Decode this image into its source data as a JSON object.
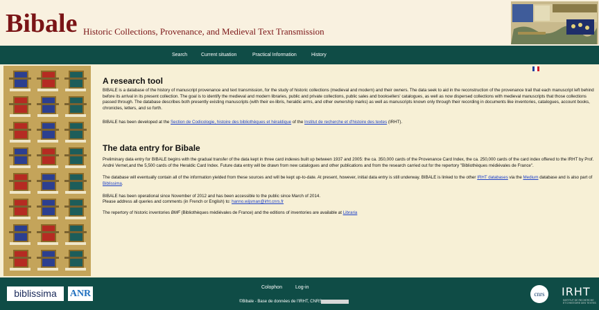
{
  "header": {
    "logo": "Bibale",
    "subtitle": "Historic Collections, Provenance, and Medieval Text Transmission"
  },
  "nav": {
    "items": [
      {
        "label": "Search"
      },
      {
        "label": "Current situation"
      },
      {
        "label": "Practical Information"
      },
      {
        "label": "History"
      }
    ]
  },
  "flag": {
    "colors": [
      "#1f3f9c",
      "#ffffff",
      "#d21b27"
    ]
  },
  "section1": {
    "title": "A research tool",
    "p1": "BIBALE is a database of the history of manuscript provenance and text transmission, for the study of historic collections (medieval and modern) and their owners. The data seek to aid in the reconstruction of the provenance trail that each manuscript left behind before its arrival in its present collection. The goal is to identify the medieval and modern libraries, public and private collections, public sales and booksellers' catalogues, as well as now dispersed collections with medieval manuscripts that those collections passed through. The database describes both presently existing manuscripts (with their ex-libris, heraldic arms, and other ownership marks) as well as manuscripts known only through their recording in documents like inventories, catalogues, account books, chronicles, letters, and so forth.",
    "p2_before": "BIBALE has been developed at the ",
    "p2_link1": "Section de Codicologie, histoire des bibliothèques et héraldique",
    "p2_mid": " of the ",
    "p2_link2": "Institut de recherche et d'histoire des textes",
    "p2_after": " (IRHT)."
  },
  "section2": {
    "title": "The data entry for Bibale",
    "p1": "Preliminary data entry for BIBALE begins with the gradual transfer of the data kept in three card indexes built up between 1937 and 2005: the ca. 350,000 cards of the Provenance Card Index, the ca. 250,000 cards of the card index offered to the IRHT by Prof. André Vernet,and the 5,500 cards of the Heraldic Card Index. Future data entry will be drawn from new catalogues and other publications and from the research carried out for the repertory \"Bibliothèques médiévales de France\".",
    "p2_before": "The database will eventually contain all of the information yielded from these sources and will be kept up-to-date. At present, however, initial data entry is still underway. BIBALE is linked to the other ",
    "p2_link1": "IRHT databases",
    "p2_mid1": " via the ",
    "p2_link2": "Medium",
    "p2_mid2": " database and is also part of ",
    "p2_link3": "Biblissima",
    "p2_after": ".",
    "p3": "BIBALE has been operational since November of 2012 and has been accessible to the public since March of 2014.",
    "p4_before": "Please address all queries and comments (in French or English) to: ",
    "p4_email": "hanno.wijsman@irht.cnrs.fr",
    "p5_before": "The repertory of historic inventories ",
    "p5_bmf": "BMF",
    "p5_mid": " (Bibliothèques médiévales de France) and the editions of inventories are available at ",
    "p5_link": "Libraria"
  },
  "footer": {
    "biblissima": "biblissima",
    "anr": "ANR",
    "colophon": "Colophon",
    "login": "Log-in",
    "copyright": "©Bibale - Base de données de l'IRHT, CNRS",
    "cnrs": "cnrs",
    "irht": "IRHT",
    "irht_sub": "INSTITUT DE RECHERCHE ET D'HISTOIRE DES TEXTES"
  }
}
